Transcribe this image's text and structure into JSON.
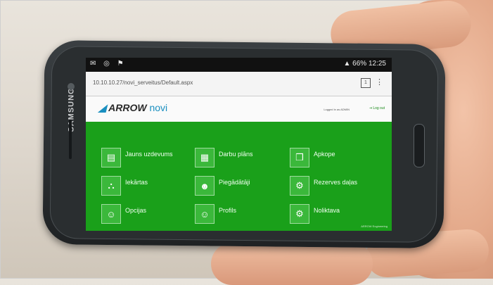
{
  "phone": {
    "brand_text": "SAMSUNG"
  },
  "status_bar": {
    "left_icons": "✉ ◎ ⚑",
    "battery": "66%",
    "time": "12:25"
  },
  "browser": {
    "url": "10.10.10.27/novi_serveitus/Default.aspx",
    "tab_count": "1"
  },
  "app": {
    "logo_brand": "ARROW",
    "logo_product": "novi",
    "login_text": "Logged in as ADMIN",
    "logout_label": "Log out",
    "footer": "ARROW Engineering",
    "tiles": [
      {
        "label": "Jauns uzdevums",
        "icon": "clipboard-icon"
      },
      {
        "label": "Darbu plāns",
        "icon": "calendar-icon"
      },
      {
        "label": "Apkope",
        "icon": "stack-icon"
      },
      {
        "label": "Iekārtas",
        "icon": "hierarchy-icon"
      },
      {
        "label": "Piegādātāji",
        "icon": "supplier-icon"
      },
      {
        "label": "Rezerves daļas",
        "icon": "gears-icon"
      },
      {
        "label": "Opcijas",
        "icon": "users-icon"
      },
      {
        "label": "Profils",
        "icon": "users-icon"
      },
      {
        "label": "Noliktava",
        "icon": "gears-icon"
      }
    ]
  },
  "colors": {
    "screen_green": "#1aa01a",
    "tile_green": "#3bb83b",
    "accent_blue": "#1a8fc0"
  }
}
